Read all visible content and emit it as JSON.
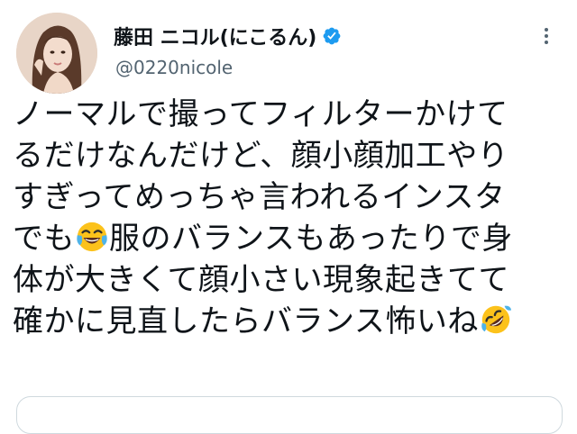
{
  "author": {
    "display_name": "藤田 ニコル(にこるん)",
    "handle": "@0220nicole",
    "verified": true,
    "verified_color": "#1d9bf0"
  },
  "tweet": {
    "lines": [
      "ノーマルで撮ってフィルターかけて",
      "るだけなんだけど、顔小顔加工やり",
      "すぎってめっちゃ言われるインスタ",
      "でも",
      "服のバランスもあったりで身",
      "体が大きくて顔小さい現象起きてて",
      "確かに見直したらバランス怖いね"
    ],
    "emojis": [
      "face-with-tears-of-joy",
      "rolling-on-the-floor-laughing"
    ]
  },
  "icons": {
    "more": "more-icon",
    "verified": "verified-badge-icon"
  }
}
